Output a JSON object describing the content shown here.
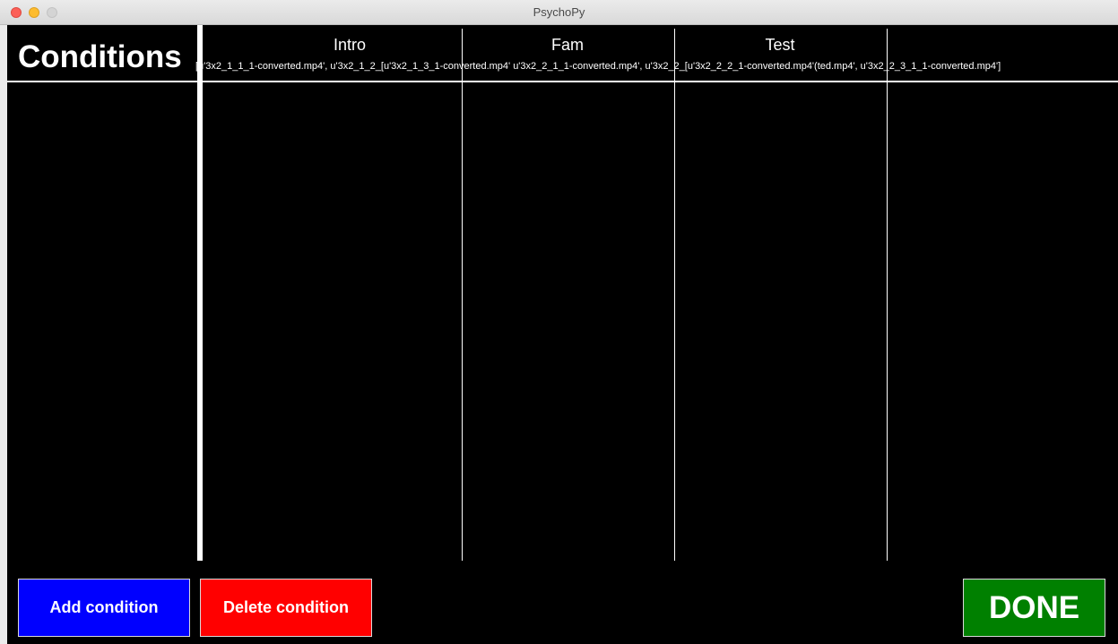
{
  "window": {
    "title": "PsychoPy"
  },
  "header": {
    "title": "Conditions"
  },
  "columns": [
    {
      "label": "Intro"
    },
    {
      "label": "Fam"
    },
    {
      "label": "Test"
    }
  ],
  "condition_row": {
    "files_text": "[u'3x2_1_1_1-converted.mp4', u'3x2_1_2_[u'3x2_1_3_1-converted.mp4' u'3x2_2_1_1-converted.mp4', u'3x2_2_[u'3x2_2_2_1-converted.mp4'(ted.mp4', u'3x2_2_3_1_1-converted.mp4']"
  },
  "buttons": {
    "add": "Add condition",
    "delete": "Delete condition",
    "done": "DONE"
  },
  "colors": {
    "background": "#000000",
    "add_button": "#0000ff",
    "delete_button": "#ff0000",
    "done_button": "#008000",
    "lines": "#ffffff"
  }
}
